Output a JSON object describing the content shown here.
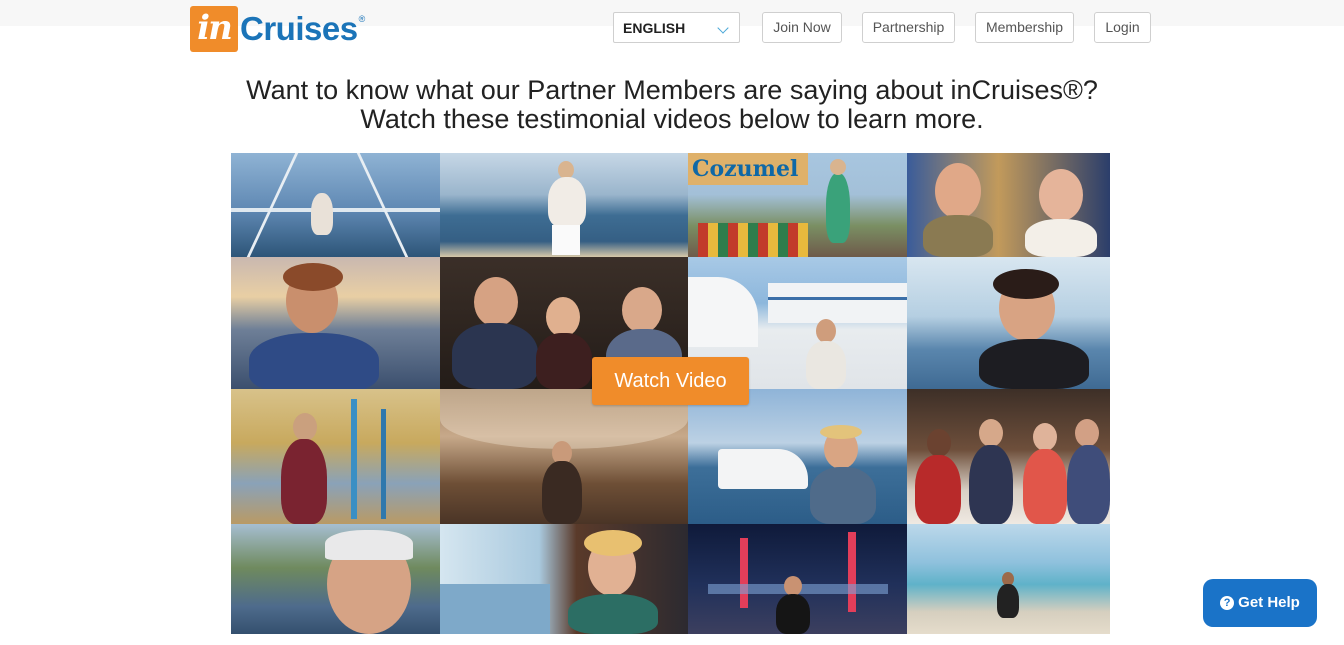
{
  "brand": {
    "logo_mark": "in",
    "logo_text": "Cruises",
    "logo_reg": "®"
  },
  "header": {
    "language": {
      "selected": "ENGLISH",
      "icon": "chevron-down-icon"
    },
    "nav": [
      {
        "label": "Join Now"
      },
      {
        "label": "Partnership"
      },
      {
        "label": "Membership"
      },
      {
        "label": "Login"
      }
    ]
  },
  "main": {
    "headline_line1": "Want to know what our Partner Members are saying about inCruises®?",
    "headline_line2": "Watch these testimonial videos below to learn more.",
    "watch_video_label": "Watch Video",
    "collage_sign_text": "Cozumel"
  },
  "help": {
    "label": "Get Help",
    "icon": "question-circle-icon"
  },
  "colors": {
    "accent_orange": "#f08c2a",
    "brand_blue": "#1b74b8",
    "help_blue": "#1a73c8"
  }
}
